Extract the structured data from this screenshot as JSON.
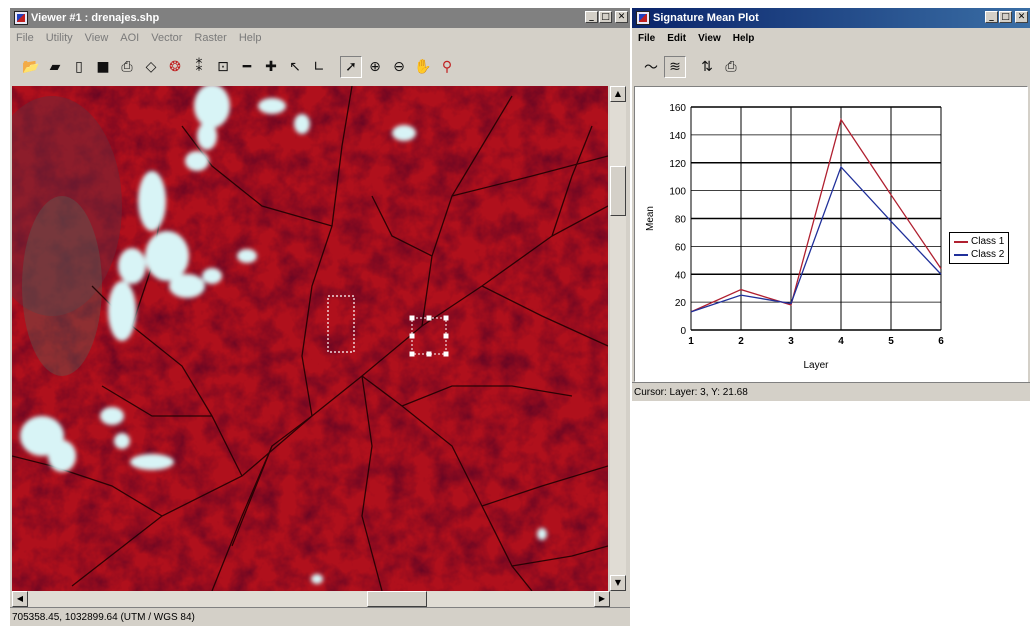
{
  "viewer": {
    "title": "Viewer #1 : drenajes.shp",
    "menu": [
      "File",
      "Utility",
      "View",
      "AOI",
      "Vector",
      "Raster",
      "Help"
    ],
    "toolbar_icons": [
      "open-folder-icon",
      "open-layer-icon",
      "new-document-icon",
      "save-icon",
      "print-icon",
      "erase-icon",
      "globe-icon",
      "fit-extent-icon",
      "zoom-extent-icon",
      "minus-icon",
      "crosshair-icon",
      "hook-icon",
      "axis-icon",
      "select-arrow-icon",
      "zoom-in-icon",
      "zoom-out-icon",
      "pan-hand-icon",
      "pick-tool-icon"
    ],
    "status": "705358.45, 1032899.64  (UTM / WGS 84)",
    "colors": {
      "title_active": "#808080",
      "image_base": "#b0101c"
    }
  },
  "plot": {
    "title": "Signature Mean Plot",
    "menu": [
      "File",
      "Edit",
      "View",
      "Help"
    ],
    "toolbar_icons": [
      "line-icon",
      "layers-icon",
      "switch-icon",
      "print-icon"
    ],
    "status": "Cursor: Layer: 3, Y: 21.68",
    "colors": {
      "title_active": "#0a246a"
    }
  },
  "chart_data": {
    "type": "line",
    "xlabel": "Layer",
    "ylabel": "Mean",
    "x": [
      1,
      2,
      3,
      4,
      5,
      6
    ],
    "xlim": [
      1,
      6
    ],
    "ylim": [
      0,
      160
    ],
    "yticks": [
      0,
      20,
      40,
      60,
      80,
      100,
      120,
      140,
      160
    ],
    "grid": true,
    "legend_position": "right",
    "series": [
      {
        "name": "Class 1",
        "color": "#b02030",
        "values": [
          13,
          29,
          18,
          151,
          97,
          44
        ]
      },
      {
        "name": "Class 2",
        "color": "#20309a",
        "values": [
          13,
          25,
          19,
          117,
          78,
          40
        ]
      }
    ]
  }
}
